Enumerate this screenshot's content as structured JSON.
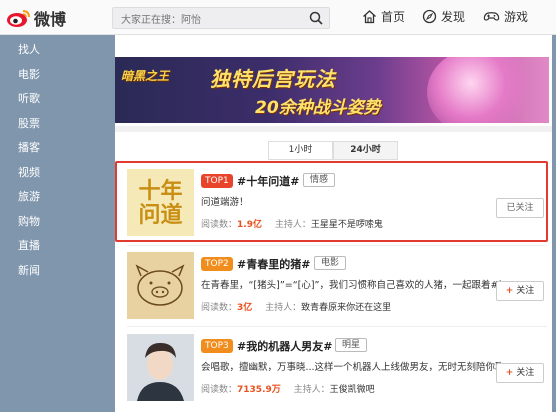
{
  "app": {
    "name": "微博"
  },
  "search": {
    "placeholder": "大家正在搜：阿怡"
  },
  "nav": [
    {
      "label": "首页",
      "icon": "home-icon"
    },
    {
      "label": "发现",
      "icon": "compass-icon"
    },
    {
      "label": "游戏",
      "icon": "game-icon"
    }
  ],
  "sidebar": {
    "items": [
      {
        "label": "找人"
      },
      {
        "label": "电影"
      },
      {
        "label": "听歌"
      },
      {
        "label": "股票"
      },
      {
        "label": "播客"
      },
      {
        "label": "视频"
      },
      {
        "label": "旅游"
      },
      {
        "label": "购物"
      },
      {
        "label": "直播"
      },
      {
        "label": "新闻"
      }
    ]
  },
  "banner": {
    "line1_left": "暗黑之王",
    "line1": "独特后宫玩法",
    "line2": "20余种战斗姿势"
  },
  "tabs": [
    {
      "label": "1小时"
    },
    {
      "label": "24小时"
    }
  ],
  "topics": [
    {
      "rank": "TOP1",
      "title": "#十年问道#",
      "category": "情感",
      "desc": "问道端游！",
      "read_label": "阅读数：",
      "reads": "1.9亿",
      "host_label": "主持人：",
      "host": "王星星不是啰嗦鬼",
      "button": "已关注",
      "thumb_text": "十年问道"
    },
    {
      "rank": "TOP2",
      "title": "#青春里的猪#",
      "category": "电影",
      "desc": "在青春里，“[猪头]”=“[心]”，我们习惯称自己喜欢的人猪，一起跟着#青春里",
      "read_label": "阅读数：",
      "reads": "3亿",
      "host_label": "主持人：",
      "host": "致青春原来你还在这里",
      "button_plus": "+",
      "button": "关注"
    },
    {
      "rank": "TOP3",
      "title": "#我的机器人男友#",
      "category": "明星",
      "desc": "会唱歌，擅幽默，万事晓...这样一个机器人上线做男友，无时无刻陪你聊...",
      "read_label": "阅读数：",
      "reads": "7135.9万",
      "host_label": "主持人：",
      "host": "王俊凯微吧",
      "button_plus": "+",
      "button": "关注"
    }
  ],
  "colors": {
    "accent": "#e8442b",
    "sidebar_bg": "#7f96ad",
    "highlight": "#e23a2e"
  }
}
